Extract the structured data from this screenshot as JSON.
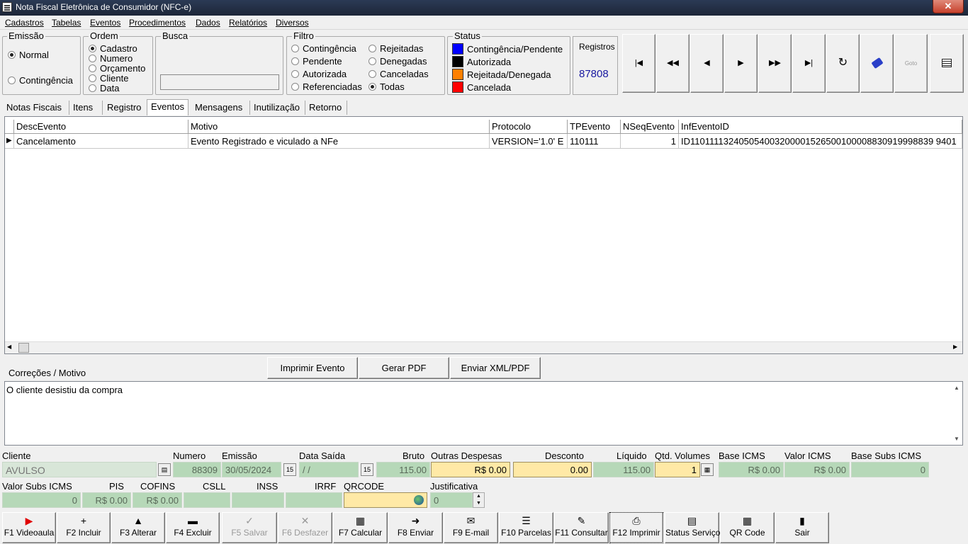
{
  "window": {
    "title": "Nota Fiscal Eletrônica de Consumidor (NFC-e)",
    "close": "✕"
  },
  "menu": [
    "Cadastros",
    "Tabelas",
    "Eventos",
    "Procedimentos",
    "Dados",
    "Relatórios",
    "Diversos"
  ],
  "emissao": {
    "label": "Emissão",
    "opt1": "Normal",
    "opt2": "Contingência",
    "selected": "Normal"
  },
  "ordem": {
    "label": "Ordem",
    "opts": [
      "Cadastro",
      "Numero",
      "Orçamento",
      "Cliente",
      "Data"
    ],
    "selected": "Cadastro"
  },
  "busca": {
    "label": "Busca",
    "value": ""
  },
  "filtro": {
    "label": "Filtro",
    "col1": [
      "Contingência",
      "Pendente",
      "Autorizada",
      "Referenciadas"
    ],
    "col2": [
      "Rejeitadas",
      "Denegadas",
      "Canceladas",
      "Todas"
    ],
    "selected": "Todas"
  },
  "status": {
    "label": "Status",
    "items": [
      {
        "label": "Contingência/Pendente",
        "color": "#0000ff"
      },
      {
        "label": "Autorizada",
        "color": "#000000"
      },
      {
        "label": "Rejeitada/Denegada",
        "color": "#ff8000"
      },
      {
        "label": "Cancelada",
        "color": "#ff0000"
      }
    ]
  },
  "registros": {
    "label": "Registros",
    "value": "87808"
  },
  "nav": {
    "first": "|◀",
    "prior_page": "◀◀",
    "prior": "◀",
    "next": "▶",
    "next_page": "▶▶",
    "last": "▶|",
    "refresh": "↻",
    "goto_label": "Goto"
  },
  "tabs": [
    "Notas Fiscais",
    "Itens",
    "Registro",
    "Eventos",
    "Mensagens",
    "Inutilização",
    "Retorno"
  ],
  "active_tab": "Eventos",
  "grid": {
    "columns": [
      "DescEvento",
      "Motivo",
      "Protocolo",
      "TPEvento",
      "NSeqEvento",
      "InfEventoID"
    ],
    "rows": [
      [
        "Cancelamento",
        "Evento Registrado e viculado a NFe",
        "VERSION='1.0' E",
        "110111",
        "1",
        "ID110111132405054003200001526500100008830919998839 9401"
      ]
    ]
  },
  "correcoes": {
    "label": "Correções / Motivo",
    "text": "O cliente desistiu da compra"
  },
  "actions": {
    "imprimir": "Imprimir Evento",
    "gerar_pdf": "Gerar PDF",
    "enviar": "Enviar XML/PDF"
  },
  "fields": {
    "cliente": {
      "label": "Cliente",
      "value": "AVULSO"
    },
    "numero": {
      "label": "Numero",
      "value": "88309"
    },
    "emissao": {
      "label": "Emissão",
      "value": "30/05/2024"
    },
    "data_saida": {
      "label": "Data Saída",
      "value": " / /"
    },
    "bruto": {
      "label": "Bruto",
      "value": "115.00"
    },
    "outras": {
      "label": "Outras Despesas",
      "value": "R$ 0.00"
    },
    "desconto": {
      "label": "Desconto",
      "value": "0.00"
    },
    "liquido": {
      "label": "Líquido",
      "value": "115.00"
    },
    "volumes": {
      "label": "Qtd. Volumes",
      "value": "1"
    },
    "base_icms": {
      "label": "Base ICMS",
      "value": "R$ 0.00"
    },
    "valor_icms": {
      "label": "Valor ICMS",
      "value": "R$ 0.00"
    },
    "base_subs": {
      "label": "Base Subs ICMS",
      "value": "0"
    },
    "valor_subs": {
      "label": "Valor Subs ICMS",
      "value": "0"
    },
    "pis": {
      "label": "PIS",
      "value": "R$ 0.00"
    },
    "cofins": {
      "label": "COFINS",
      "value": "R$ 0.00"
    },
    "csll": {
      "label": "CSLL",
      "value": ""
    },
    "inss": {
      "label": "INSS",
      "value": ""
    },
    "irrf": {
      "label": "IRRF",
      "value": ""
    },
    "qrcode": {
      "label": "QRCODE",
      "value": ""
    },
    "justificativa": {
      "label": "Justificativa",
      "value": "0"
    }
  },
  "fkeys": [
    {
      "label": "F1 Videoaula",
      "icon": "▶",
      "color": "#e00000"
    },
    {
      "label": "F2 Incluir",
      "icon": "+"
    },
    {
      "label": "F3 Alterar",
      "icon": "▲"
    },
    {
      "label": "F4 Excluir",
      "icon": "▬"
    },
    {
      "label": "F5 Salvar",
      "icon": "✓"
    },
    {
      "label": "F6 Desfazer",
      "icon": "✕"
    },
    {
      "label": "F7 Calcular",
      "icon": "▦"
    },
    {
      "label": "F8 Enviar",
      "icon": "➜"
    },
    {
      "label": "F9 E-mail",
      "icon": "✉"
    },
    {
      "label": "F10 Parcelas",
      "icon": "☰"
    },
    {
      "label": "F11 Consultar",
      "icon": "✎"
    },
    {
      "label": "F12 Imprimir",
      "icon": "⎙"
    },
    {
      "label": "Status Serviço",
      "icon": "▤"
    },
    {
      "label": "QR Code",
      "icon": "▦"
    },
    {
      "label": "Sair",
      "icon": "▮"
    }
  ]
}
